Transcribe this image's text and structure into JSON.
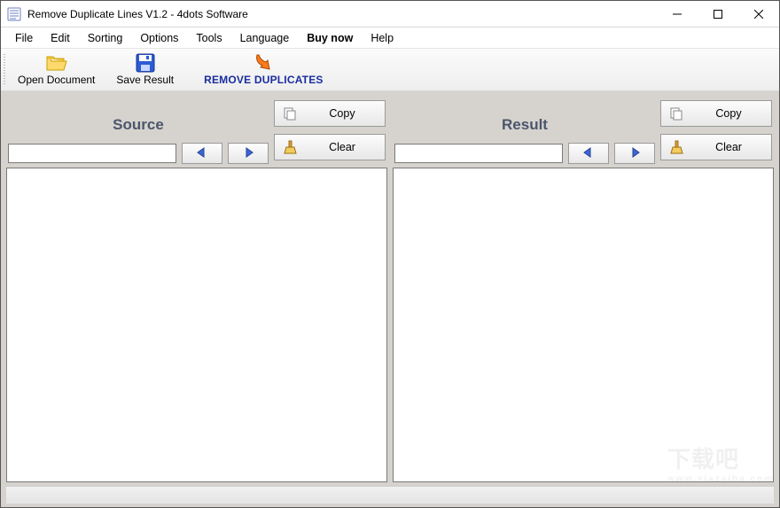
{
  "title": "Remove Duplicate Lines V1.2 - 4dots Software",
  "menu": {
    "file": "File",
    "edit": "Edit",
    "sorting": "Sorting",
    "options": "Options",
    "tools": "Tools",
    "language": "Language",
    "buynow": "Buy now",
    "help": "Help"
  },
  "toolbar": {
    "open": "Open Document",
    "save": "Save Result",
    "remove": "REMOVE DUPLICATES"
  },
  "panes": {
    "source": {
      "title": "Source",
      "copy": "Copy",
      "clear": "Clear",
      "search_value": "",
      "search_placeholder": "",
      "text": ""
    },
    "result": {
      "title": "Result",
      "copy": "Copy",
      "clear": "Clear",
      "search_value": "",
      "search_placeholder": "",
      "text": ""
    }
  },
  "icons": {
    "app": "document-list-icon",
    "minimize": "minimize-icon",
    "maximize": "maximize-icon",
    "close": "close-icon",
    "folder": "open-folder-icon",
    "save": "floppy-disk-icon",
    "remove": "arrow-down-right-icon",
    "copy": "copy-icon",
    "clear": "broom-icon",
    "left": "arrow-left-icon",
    "right": "arrow-right-icon"
  },
  "watermark": {
    "big": "下载吧",
    "small": "www.xiazaiba.com"
  }
}
